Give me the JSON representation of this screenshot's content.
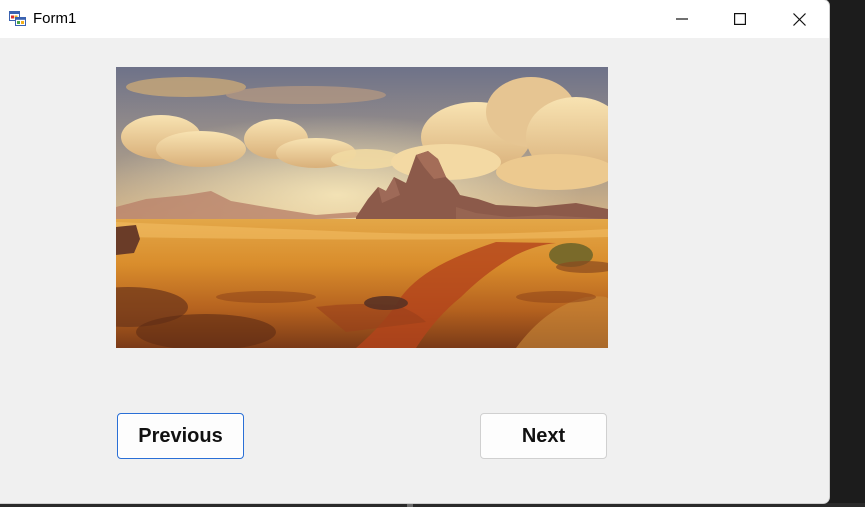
{
  "window": {
    "title": "Form1",
    "icon": "form-app-icon",
    "controls": {
      "minimize_icon": "minimize-icon",
      "maximize_icon": "maximize-icon",
      "close_icon": "close-icon"
    }
  },
  "picture": {
    "description_icon": "desert-landscape-image"
  },
  "buttons": {
    "previous_label": "Previous",
    "next_label": "Next"
  },
  "colors": {
    "focus_border": "#2a6fd6",
    "form_background": "#f0f0f0",
    "titlebar_background": "#ffffff"
  }
}
